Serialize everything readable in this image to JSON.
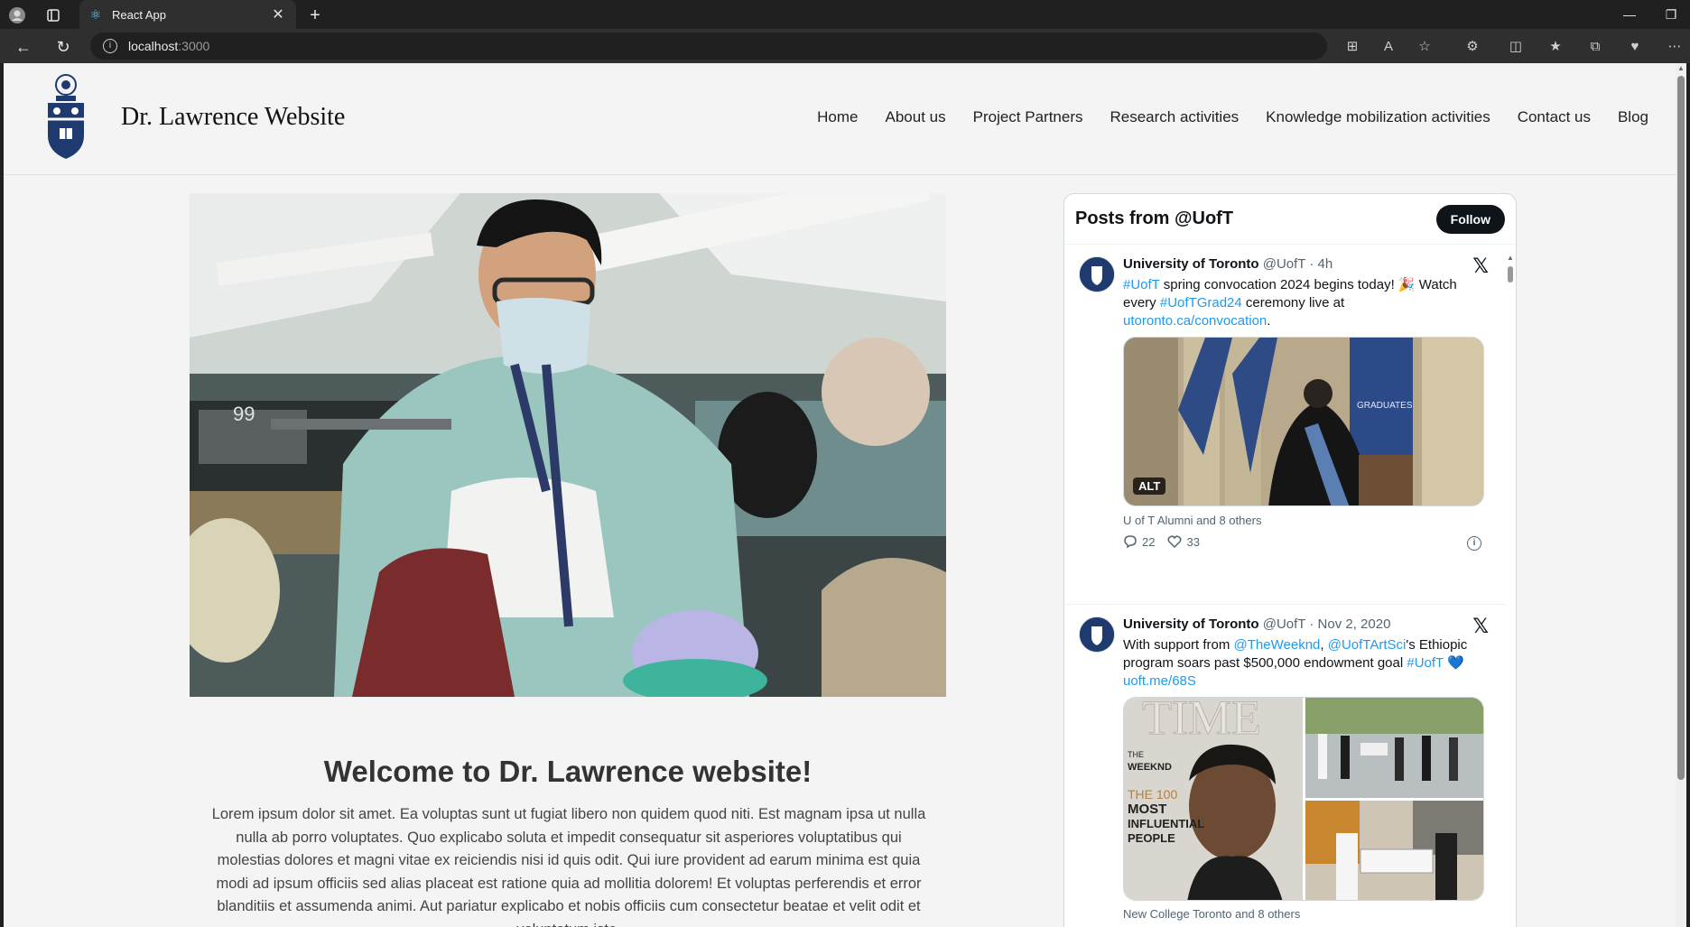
{
  "browser": {
    "tab_title": "React App",
    "url_host": "localhost",
    "url_port": ":3000"
  },
  "site": {
    "title": "Dr. Lawrence Website",
    "nav": [
      "Home",
      "About us",
      "Project Partners",
      "Research activities",
      "Knowledge mobilization activities",
      "Contact us",
      "Blog"
    ]
  },
  "main": {
    "welcome": "Welcome to Dr. Lawrence website!",
    "body": "Lorem ipsum dolor sit amet. Ea voluptas sunt ut fugiat libero non quidem quod niti. Est magnam ipsa ut nulla nulla ab porro voluptates. Quo explicabo soluta et impedit consequatur sit asperiores voluptatibus qui molestias dolores et magni vitae ex reiciendis nisi id quis odit. Qui iure provident ad earum minima est quia modi ad ipsum officiis sed alias placeat est ratione quia ad mollitia dolorem! Et voluptas perferendis et error blanditiis et assumenda animi. Aut pariatur explicabo et nobis officiis cum consectetur beatae et velit odit et voluptatum iste."
  },
  "twitter": {
    "header": "Posts from @UofT",
    "follow": "Follow",
    "tweets": [
      {
        "name": "University of Toronto",
        "handle": "@UofT",
        "time": "· 4h",
        "text_parts": [
          "#UofT",
          " spring convocation 2024 begins today! 🎉 Watch every ",
          "#UofTGrad24",
          " ceremony live at ",
          "utoronto.ca/convocation",
          "."
        ],
        "media_alt_badge": "ALT",
        "liked_by": "U of T Alumni and 8 others",
        "replies": "22",
        "likes": "33"
      },
      {
        "name": "University of Toronto",
        "handle": "@UofT",
        "time": "· Nov 2, 2020",
        "text_parts": [
          "With support from ",
          "@TheWeeknd",
          ", ",
          "@UofTArtSci",
          "'s Ethiopic program soars past $500,000 endowment goal ",
          "#UofT",
          " 💙 ",
          "uoft.me/68S"
        ],
        "liked_by": "New College Toronto and 8 others",
        "magazine_masthead": "TIME",
        "magazine_cover_lines": [
          "THE",
          "WEEKND",
          "THE 100",
          "MOST",
          "INFLUENTIAL",
          "PEOPLE"
        ]
      }
    ]
  },
  "colors": {
    "link": "#1d9bf0",
    "uoft_navy": "#1f3a6e"
  }
}
